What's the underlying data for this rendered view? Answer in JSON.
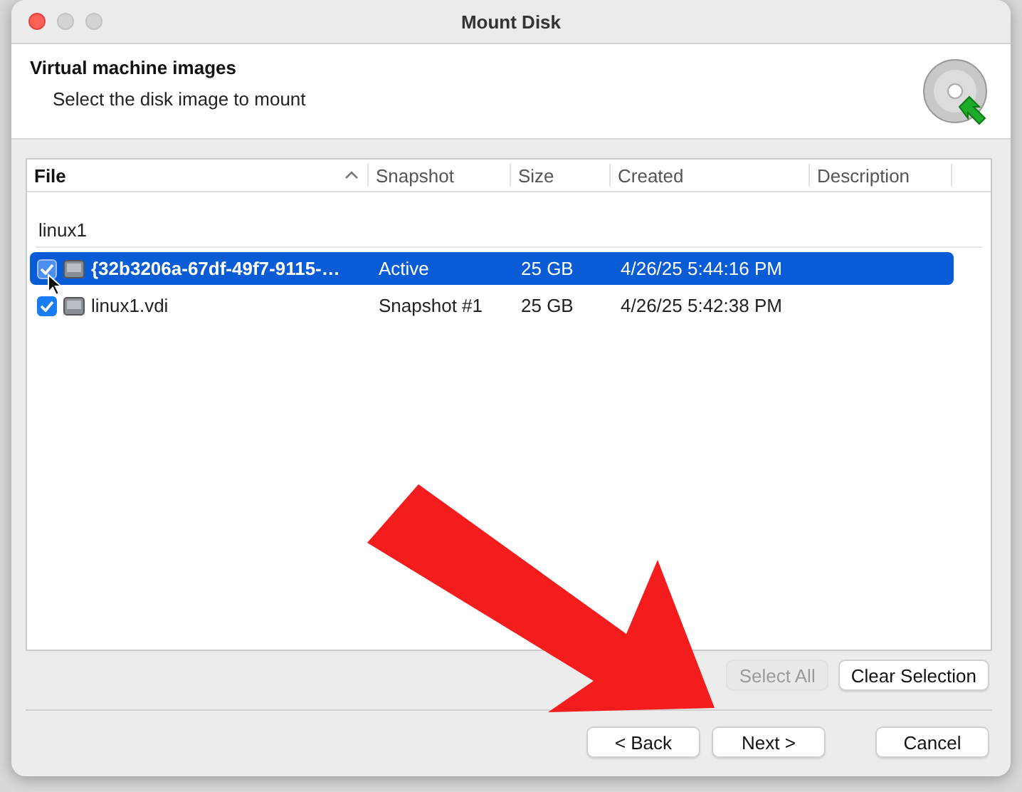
{
  "window": {
    "title": "Mount Disk"
  },
  "header": {
    "title": "Virtual machine images",
    "subtitle": "Select the disk image to mount"
  },
  "table": {
    "columns": [
      {
        "label": "File",
        "sorted": true
      },
      {
        "label": "Snapshot",
        "sorted": false
      },
      {
        "label": "Size",
        "sorted": false
      },
      {
        "label": "Created",
        "sorted": false
      },
      {
        "label": "Description",
        "sorted": false
      }
    ],
    "group": "linux1",
    "rows": [
      {
        "checked": true,
        "selected": true,
        "file": "{32b3206a-67df-49f7-9115-…",
        "snapshot": "Active",
        "size": "25 GB",
        "created": "4/26/25 5:44:16 PM"
      },
      {
        "checked": true,
        "selected": false,
        "file": "linux1.vdi",
        "snapshot": "Snapshot #1",
        "size": "25 GB",
        "created": "4/26/25 5:42:38 PM"
      }
    ]
  },
  "selection_buttons": [
    {
      "label": "Select All",
      "disabled": true
    },
    {
      "label": "Clear Selection",
      "disabled": false
    }
  ],
  "nav_buttons": [
    {
      "label": "< Back",
      "kind": "nav"
    },
    {
      "label": "Next >",
      "kind": "nav"
    },
    {
      "label": "Cancel",
      "kind": "cancel"
    }
  ]
}
